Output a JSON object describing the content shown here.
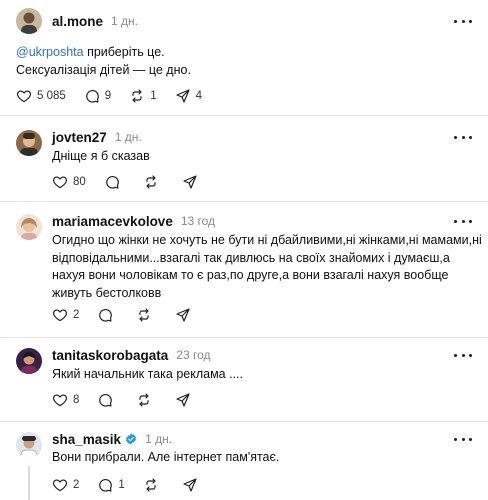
{
  "posts": [
    {
      "username": "al.mone",
      "time": "1 дн.",
      "mention": "@ukrposhta",
      "line1_rest": " приберіть це.",
      "line2": "Сексуалізація дітей — це дно.",
      "likes": "5 085",
      "comments": "9",
      "reposts": "1",
      "shares": "4"
    },
    {
      "username": "jovten27",
      "time": "1 дн.",
      "text": "Дніще я б сказав",
      "likes": "80"
    },
    {
      "username": "mariamacevkolove",
      "time": "13 год",
      "line1": "Огидно що жінки не хочуть не бути ні дбайливими,ні жінками,ні мамами,ні",
      "line2": "відповідальними...взагалі так дивлюсь на своїх знайомих і думаєш,а",
      "line3": "нахуя вони чоловікам то є раз,по друге,а вони взагалі нахуя вообще",
      "line4": "живуть бестолковв",
      "likes": "2"
    },
    {
      "username": "tanitaskorobagata",
      "time": "23 год",
      "text": "Який начальник така реклама ....",
      "likes": "8"
    },
    {
      "username": "sha_masik",
      "time": "1 дн.",
      "text": "Вони прибрали. Але інтернет пам'ятає.",
      "likes": "2",
      "comments": "1"
    }
  ],
  "icons": {
    "like": "heart-icon",
    "comment": "comment-icon",
    "repost": "repost-icon",
    "share": "share-icon",
    "more": "more-icon",
    "verified": "verified-badge-icon"
  },
  "colors": {
    "mention": "#2f6fd1",
    "verified": "#1d9bf0",
    "muted": "#8a8a8a"
  }
}
